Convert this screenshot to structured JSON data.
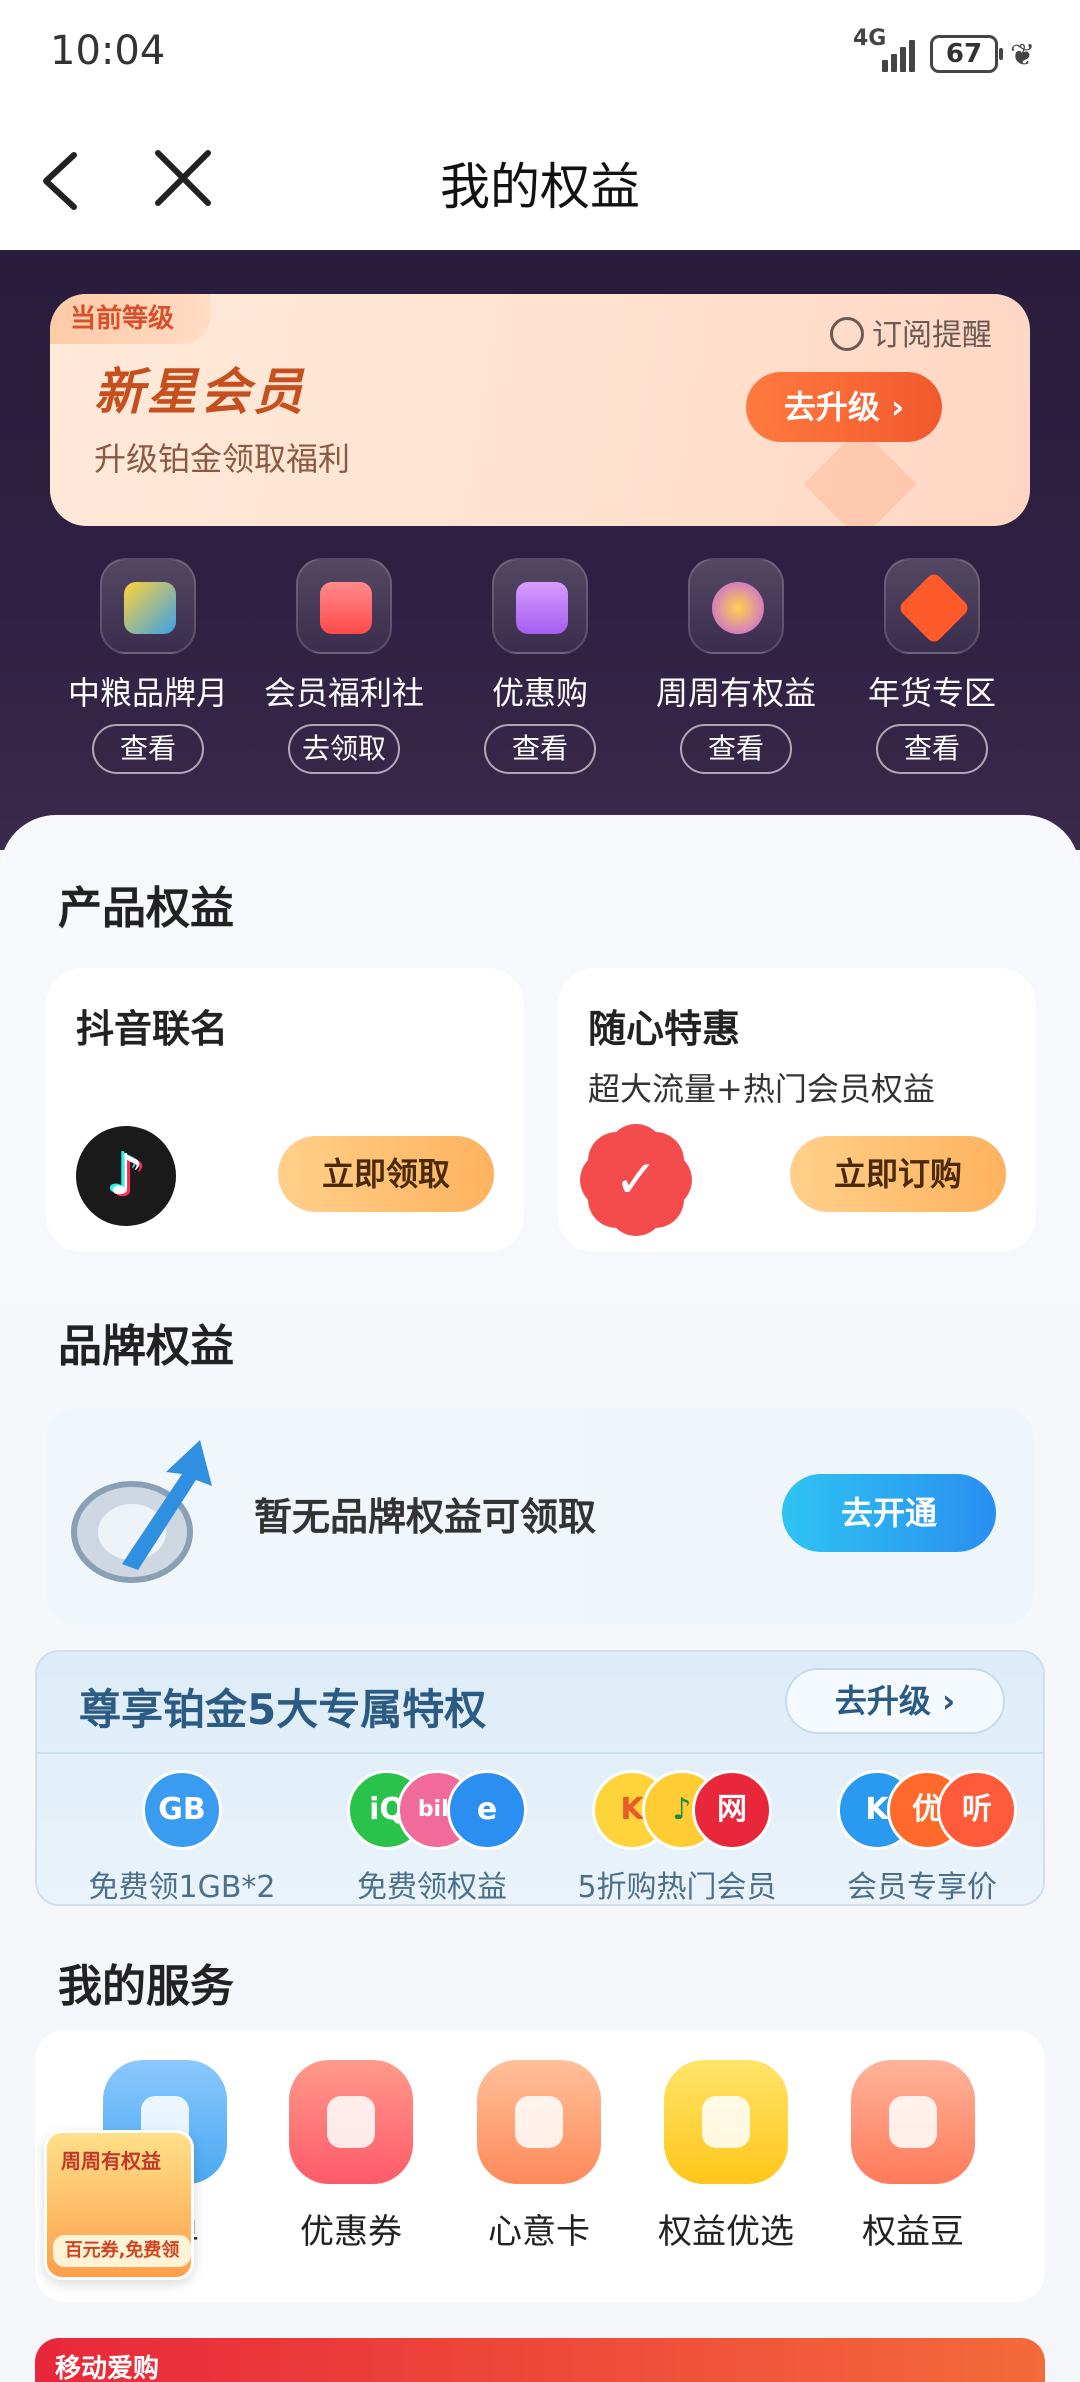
{
  "status_bar": {
    "time": "10:04",
    "network": "4G",
    "battery": "67"
  },
  "nav": {
    "title": "我的权益"
  },
  "level": {
    "tag": "当前等级",
    "name": "新星会员",
    "subtitle": "升级铂金领取福利",
    "subscribe_label": "订阅提醒",
    "upgrade_label": "去升级 ›"
  },
  "tiles": [
    {
      "label": "中粮品牌月",
      "button": "查看",
      "icon": "cube-icon",
      "color": "#3aa0e8"
    },
    {
      "label": "会员福利社",
      "button": "去领取",
      "icon": "gift-icon",
      "color": "#ff5a5a"
    },
    {
      "label": "优惠购",
      "button": "查看",
      "icon": "wallet-icon",
      "color": "#b06af0"
    },
    {
      "label": "周周有权益",
      "button": "查看",
      "icon": "coupon-icon",
      "color": "#f0a030"
    },
    {
      "label": "年货专区",
      "button": "查看",
      "icon": "new-year-icon",
      "color": "#ff5a2a"
    }
  ],
  "product": {
    "title": "产品权益",
    "cards": [
      {
        "title": "抖音联名",
        "subtitle": "",
        "button": "立即领取"
      },
      {
        "title": "随心特惠",
        "subtitle": "超大流量+热门会员权益",
        "button": "立即订购"
      }
    ]
  },
  "brand": {
    "title": "品牌权益",
    "empty_text": "暂无品牌权益可领取",
    "button": "去开通"
  },
  "platinum": {
    "title": "尊享铂金5大专属特权",
    "button": "去升级 ›",
    "perks": [
      {
        "label": "免费领1GB*2",
        "icons": [
          "GB"
        ]
      },
      {
        "label": "免费领权益",
        "icons": [
          "iQ",
          "bili",
          "e"
        ]
      },
      {
        "label": "5折购热门会员",
        "icons": [
          "K",
          "♪",
          "网"
        ]
      },
      {
        "label": "会员专享价",
        "icons": [
          "K",
          "优",
          "听"
        ]
      }
    ]
  },
  "services": {
    "title": "我的服务",
    "items": [
      {
        "label": "订单",
        "color": "#4aa8f0"
      },
      {
        "label": "优惠券",
        "color": "#ff6a6a"
      },
      {
        "label": "心意卡",
        "color": "#ff9e6a"
      },
      {
        "label": "权益优选",
        "color": "#ffcc33"
      },
      {
        "label": "权益豆",
        "color": "#ff8a6a"
      }
    ],
    "float_badge_top": "周周有权益",
    "float_badge_bottom": "百元券,免费领"
  },
  "promo": {
    "text": "移动爱购"
  }
}
